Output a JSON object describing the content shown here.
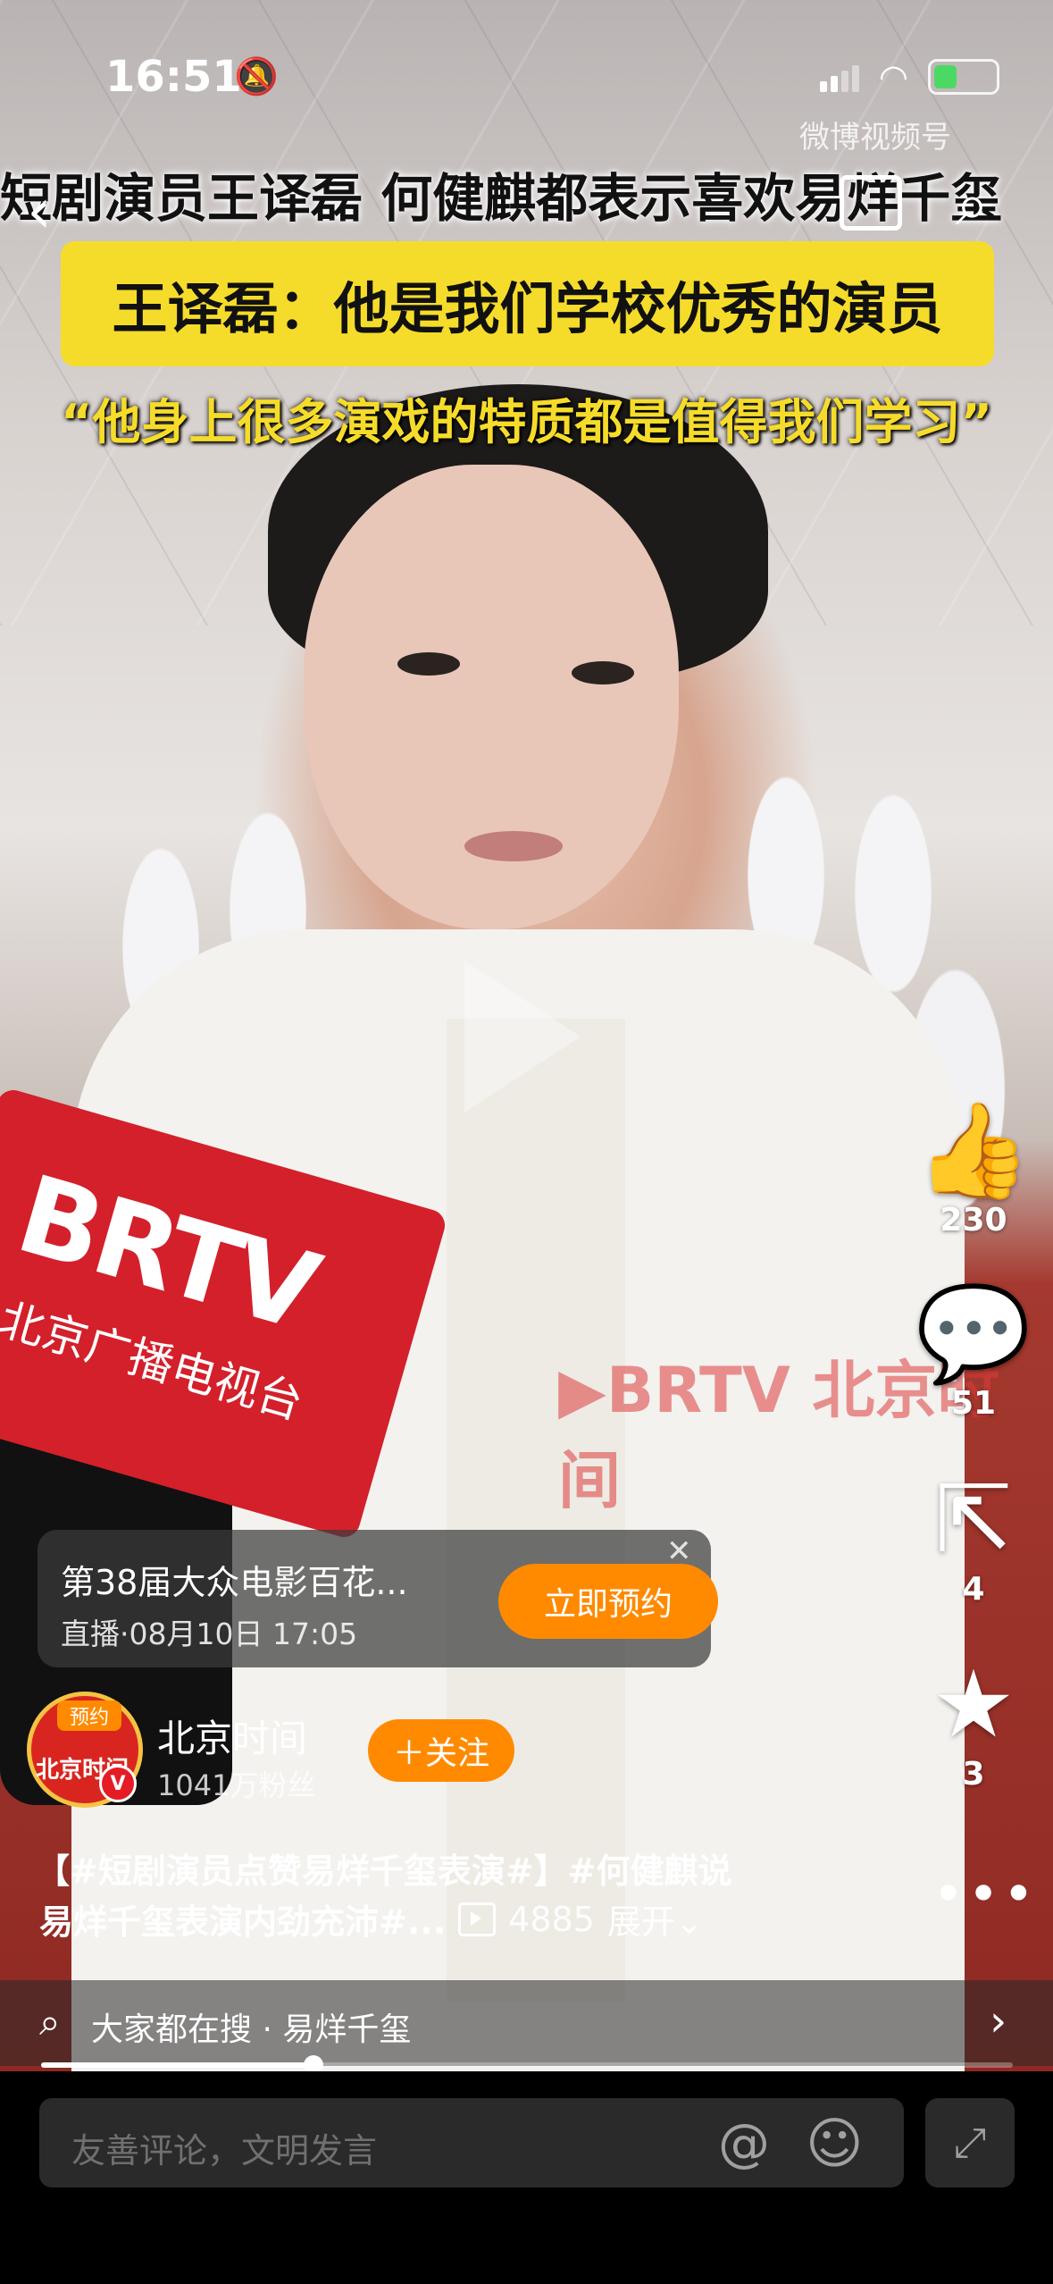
{
  "status": {
    "time": "16:51",
    "battery_level": 0.45
  },
  "header": {
    "headline": "短剧演员王译磊 何健麒都表示喜欢易烊千玺",
    "brand_mark": "微博视频号",
    "back_icon": "chevron-left-icon",
    "pip_icon": "picture-in-picture-icon",
    "search_icon": "search-icon"
  },
  "video": {
    "subtitle_box": "王译磊：他是我们学校优秀的演员",
    "subtitle_line": "“他身上很多演戏的特质都是值得我们学习”",
    "mic_logo": "BRTV",
    "mic_sub": "北京广播电视台",
    "watermark": "▶BRTV 北京时间"
  },
  "rail": {
    "likes": "230",
    "comments": "51",
    "shares": "4",
    "favorites": "3"
  },
  "promo": {
    "title": "第38届大众电影百花...",
    "subtitle": "直播·08月10日 17:05",
    "button": "立即预约",
    "close": "✕"
  },
  "account": {
    "avatar_tag": "预约",
    "avatar_text": "北京时间",
    "badge": "V",
    "name": "北京时间",
    "fans": "1041万粉丝",
    "follow_label": "＋关注"
  },
  "caption": {
    "line1": "【#短剧演员点赞易烊千玺表演#】#何健麒说",
    "line2": "易烊千玺表演内劲充沛#...",
    "views": "4885",
    "expand": "展开⌄"
  },
  "search": {
    "text": "大家都在搜 · 易烊千玺",
    "arrow": "›"
  },
  "progress": {
    "fraction": 0.28
  },
  "comment": {
    "placeholder": "友善评论，文明发言",
    "at": "@",
    "emoji": "☺",
    "expand": "⤢"
  }
}
